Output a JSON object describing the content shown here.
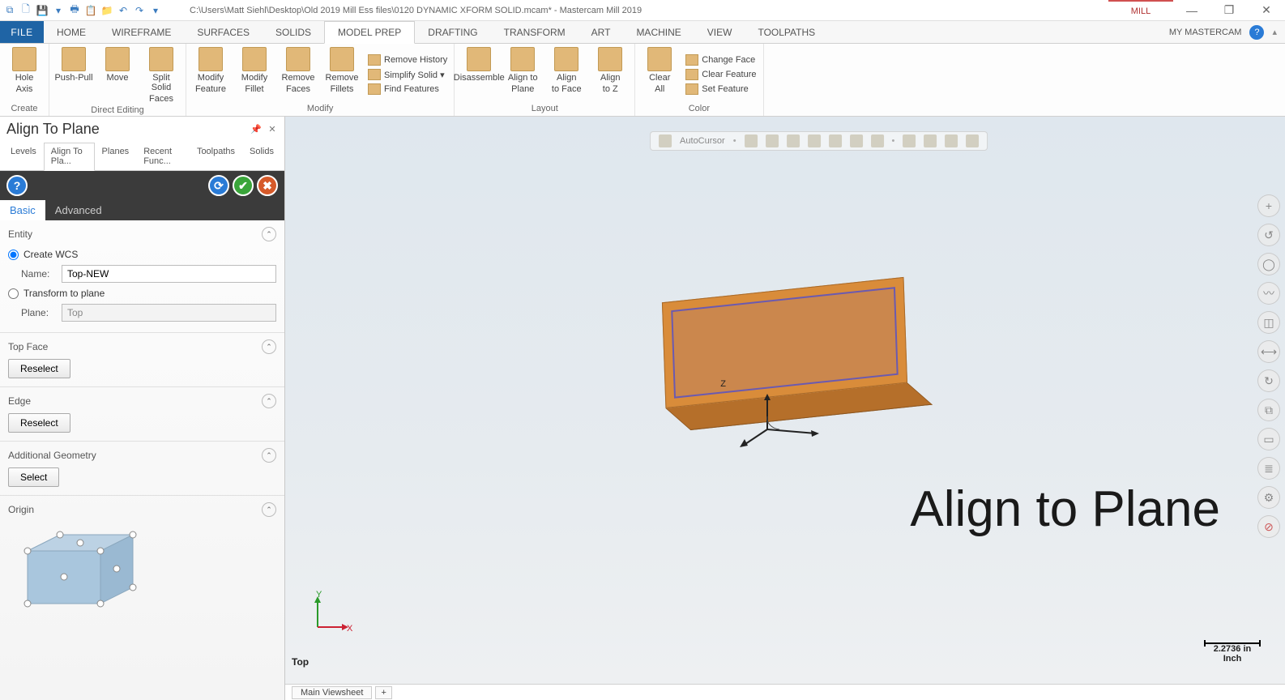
{
  "titlebar": {
    "path": "C:\\Users\\Matt Siehl\\Desktop\\Old 2019 Mill Ess files\\0120 DYNAMIC XFORM SOLID.mcam* - Mastercam Mill 2019",
    "context_tab": "MILL"
  },
  "main_tabs": {
    "file": "FILE",
    "items": [
      "HOME",
      "WIREFRAME",
      "SURFACES",
      "SOLIDS",
      "MODEL PREP",
      "DRAFTING",
      "TRANSFORM",
      "ART",
      "MACHINE",
      "VIEW",
      "TOOLPATHS"
    ],
    "active": "MODEL PREP",
    "right": "MY MASTERCAM"
  },
  "ribbon": {
    "groups": [
      {
        "label": "Create",
        "big": [
          {
            "l1": "Hole",
            "l2": "Axis"
          }
        ]
      },
      {
        "label": "Direct Editing",
        "big": [
          {
            "l1": "Push-Pull",
            "l2": ""
          },
          {
            "l1": "Move",
            "l2": ""
          },
          {
            "l1": "Split Solid",
            "l2": "Faces"
          }
        ]
      },
      {
        "label": "Modify",
        "big": [
          {
            "l1": "Modify",
            "l2": "Feature"
          },
          {
            "l1": "Modify",
            "l2": "Fillet"
          },
          {
            "l1": "Remove",
            "l2": "Faces"
          },
          {
            "l1": "Remove",
            "l2": "Fillets"
          }
        ],
        "small": [
          "Remove History",
          "Simplify Solid ▾",
          "Find Features"
        ]
      },
      {
        "label": "Layout",
        "big": [
          {
            "l1": "Disassemble",
            "l2": ""
          },
          {
            "l1": "Align to",
            "l2": "Plane"
          },
          {
            "l1": "Align",
            "l2": "to Face"
          },
          {
            "l1": "Align",
            "l2": "to Z"
          }
        ]
      },
      {
        "label": "Color",
        "big": [
          {
            "l1": "Clear",
            "l2": "All"
          }
        ],
        "small": [
          "Change Face",
          "Clear Feature",
          "Set Feature"
        ]
      }
    ]
  },
  "panel": {
    "title": "Align To Plane",
    "tabs": [
      "Levels",
      "Align To Pla...",
      "Planes",
      "Recent Func...",
      "Toolpaths",
      "Solids"
    ],
    "active_tab": "Align To Pla...",
    "mode_tabs": [
      "Basic",
      "Advanced"
    ],
    "active_mode": "Basic",
    "entity": {
      "header": "Entity",
      "create_wcs": "Create WCS",
      "name_label": "Name:",
      "name_value": "Top-NEW",
      "transform": "Transform to plane",
      "plane_label": "Plane:",
      "plane_value": "Top"
    },
    "topface": {
      "header": "Top Face",
      "btn": "Reselect"
    },
    "edge": {
      "header": "Edge",
      "btn": "Reselect"
    },
    "addgeo": {
      "header": "Additional Geometry",
      "btn": "Select"
    },
    "origin": {
      "header": "Origin"
    }
  },
  "viewport": {
    "autocursor": "AutoCursor",
    "overlay": "Align to Plane",
    "z_label": "Z",
    "axis_y": "Y",
    "axis_x": "X",
    "view_label": "Top",
    "scale_value": "2.2736 in",
    "scale_unit": "Inch"
  },
  "status": {
    "viewsheet": "Main Viewsheet",
    "plus": "+"
  }
}
